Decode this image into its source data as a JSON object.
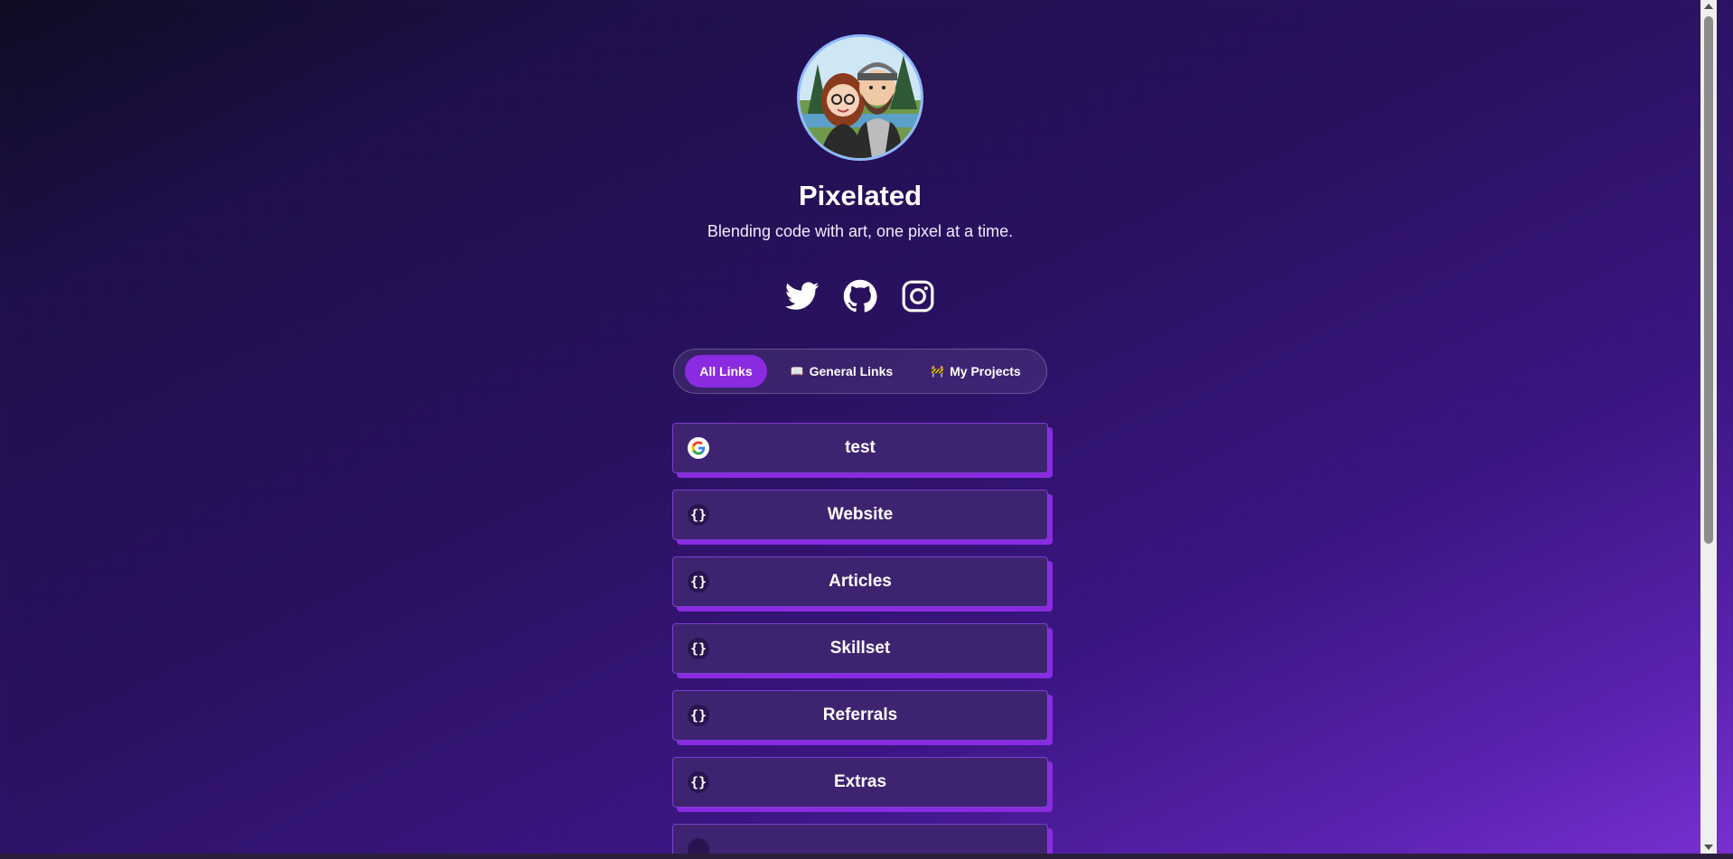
{
  "profile": {
    "name": "Pixelated",
    "tagline": "Blending code with art, one pixel at a time."
  },
  "socials": [
    {
      "icon": "twitter-icon"
    },
    {
      "icon": "github-icon"
    },
    {
      "icon": "instagram-icon"
    }
  ],
  "tabs": [
    {
      "label": "All Links",
      "emoji": "",
      "active": true
    },
    {
      "label": "General Links",
      "emoji": "📖",
      "active": false
    },
    {
      "label": "My Projects",
      "emoji": "🚧",
      "active": false
    }
  ],
  "links": [
    {
      "label": "test",
      "icon": "google-icon",
      "glyph": ""
    },
    {
      "label": "Website",
      "icon": "code-brace-icon",
      "glyph": "{}"
    },
    {
      "label": "Articles",
      "icon": "code-brace-icon",
      "glyph": "{}"
    },
    {
      "label": "Skillset",
      "icon": "code-brace-icon",
      "glyph": "{}"
    },
    {
      "label": "Referrals",
      "icon": "code-brace-icon",
      "glyph": "{}"
    },
    {
      "label": "Extras",
      "icon": "code-brace-icon",
      "glyph": "{}"
    }
  ],
  "colors": {
    "accent": "#8a2be2",
    "card": "#3e2470",
    "avatar_border": "#8fb8ff"
  }
}
